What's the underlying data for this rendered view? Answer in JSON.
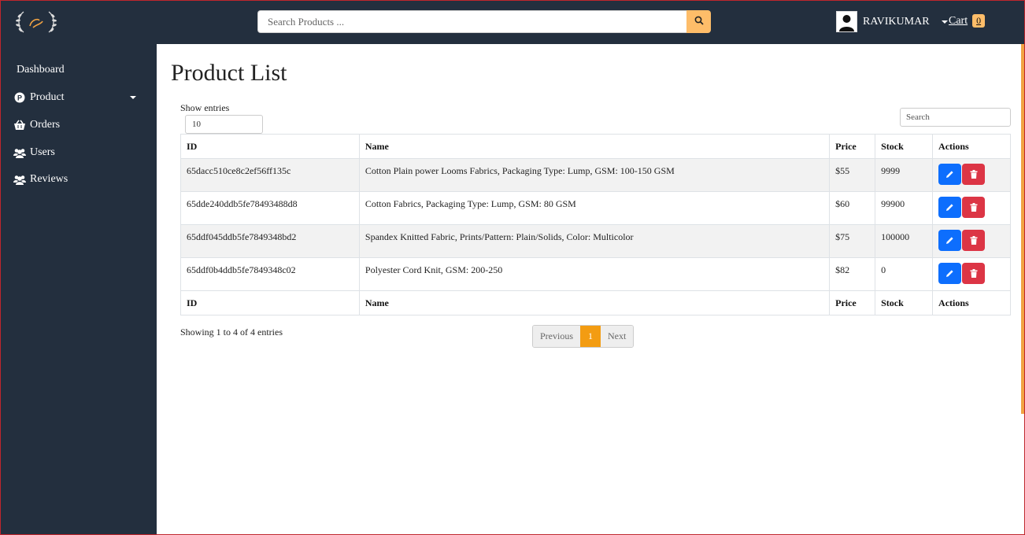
{
  "header": {
    "search_placeholder": "Search Products ...",
    "username": "RAVIKUMAR",
    "cart_label": "Cart",
    "cart_count": "0"
  },
  "sidebar": {
    "items": [
      {
        "label": "Dashboard",
        "icon": ""
      },
      {
        "label": "Product",
        "icon": "product-p-icon"
      },
      {
        "label": "Orders",
        "icon": "basket-icon"
      },
      {
        "label": "Users",
        "icon": "users-icon"
      },
      {
        "label": "Reviews",
        "icon": "users-icon"
      }
    ]
  },
  "main": {
    "title": "Product List",
    "show_entries_label": "Show entries",
    "entries_value": "10",
    "search_placeholder": "Search",
    "columns": [
      "ID",
      "Name",
      "Price",
      "Stock",
      "Actions"
    ],
    "rows": [
      {
        "id": "65dacc510ce8c2ef56ff135c",
        "name": "Cotton Plain power Looms Fabrics, Packaging Type: Lump, GSM: 100-150 GSM",
        "price": "$55",
        "stock": "9999"
      },
      {
        "id": "65dde240ddb5fe78493488d8",
        "name": "Cotton Fabrics, Packaging Type: Lump, GSM: 80 GSM",
        "price": "$60",
        "stock": "99900"
      },
      {
        "id": "65ddf045ddb5fe7849348bd2",
        "name": "Spandex Knitted Fabric, Prints/Pattern: Plain/Solids, Color: Multicolor",
        "price": "$75",
        "stock": "100000"
      },
      {
        "id": "65ddf0b4ddb5fe7849348c02",
        "name": "Polyester Cord Knit, GSM: 200-250",
        "price": "$82",
        "stock": "0"
      }
    ],
    "info_text": "Showing 1 to 4 of 4 entries",
    "pagination": {
      "previous": "Previous",
      "current": "1",
      "next": "Next"
    }
  },
  "colors": {
    "nav_bg": "#232f3e",
    "accent": "#febd69",
    "edit": "#0d6efd",
    "delete": "#dc3545",
    "page_active": "#f39c12"
  }
}
